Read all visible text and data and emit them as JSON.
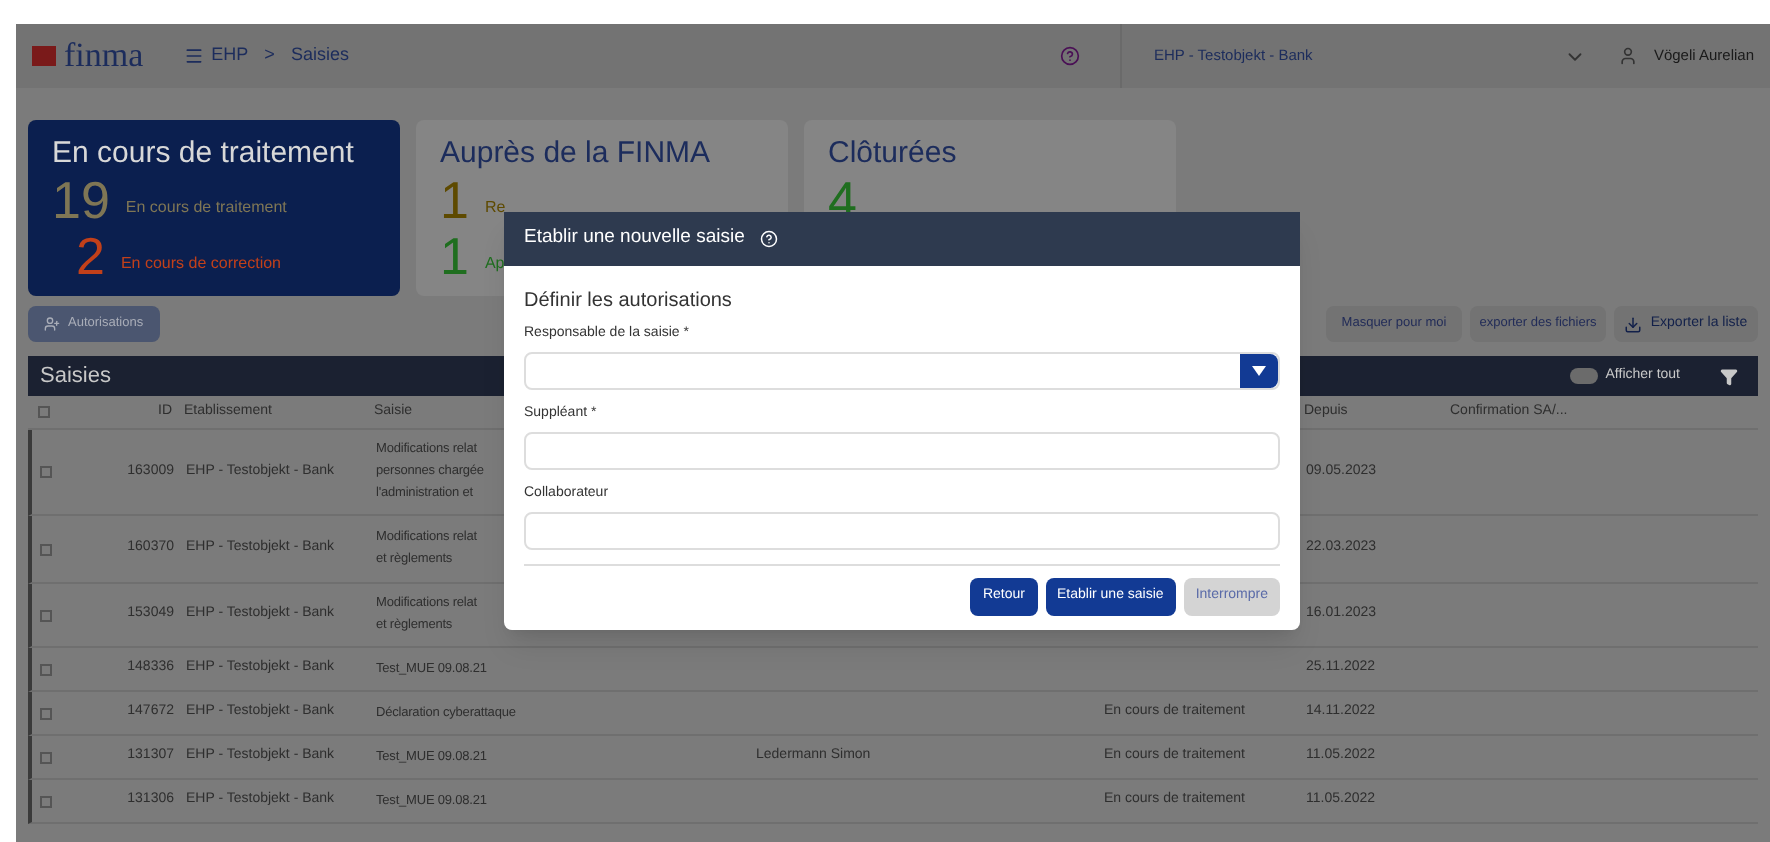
{
  "header": {
    "logo": "finma",
    "menu": "EHP",
    "breadcrumb_separator": ">",
    "page": "Saisies",
    "institution": "EHP - Testobjekt - Bank",
    "user": "Vögeli Aurelian"
  },
  "cards": [
    {
      "title": "En cours de traitement",
      "selected": true,
      "counts": [
        {
          "value": "19",
          "label": "En cours de traitement",
          "color": "#7f7655"
        },
        {
          "value": "2",
          "label": "En cours de correction",
          "color": "#c2401a"
        }
      ]
    },
    {
      "title": "Auprès de la FINMA",
      "selected": false,
      "counts": [
        {
          "value": "1",
          "label": "Re",
          "color": "#5e4a00"
        },
        {
          "value": "1",
          "label": "Ap",
          "color": "#1f6e1f"
        }
      ]
    },
    {
      "title": "Clôturées",
      "selected": false,
      "counts": [
        {
          "value": "4",
          "color": "#1f6e1f"
        }
      ]
    }
  ],
  "toolbar": {
    "left": "Autorisations",
    "right": [
      {
        "label": "Masquer pour moi",
        "kind": "plain"
      },
      {
        "label": "exporter des fichiers",
        "kind": "plain"
      },
      {
        "label": "Exporter la liste",
        "kind": "download"
      }
    ]
  },
  "table": {
    "title": "Saisies",
    "toggle": {
      "label": "Afficher tout",
      "on": false
    },
    "select_all_checked": false,
    "columns": [
      "ID",
      "Etablissement",
      "Saisie",
      "Depuis",
      "Confirmation SA/..."
    ],
    "rows": [
      {
        "checked": false,
        "id": "163009",
        "institution": "EHP - Testobjekt - Bank",
        "saisie": "Modifications relat\npersonnes chargée\nl'administration et",
        "person": "",
        "status": "",
        "since": "09.05.2023"
      },
      {
        "checked": false,
        "id": "160370",
        "institution": "EHP - Testobjekt - Bank",
        "saisie": "Modifications relat\net règlements",
        "person": "",
        "status": "",
        "since": "22.03.2023"
      },
      {
        "checked": false,
        "id": "153049",
        "institution": "EHP - Testobjekt - Bank",
        "saisie": "Modifications relat\net règlements",
        "person": "",
        "status": "",
        "since": "16.01.2023"
      },
      {
        "checked": false,
        "id": "148336",
        "institution": "EHP - Testobjekt - Bank",
        "saisie": "Test_MUE 09.08.21",
        "person": "",
        "status": "",
        "since": "25.11.2022"
      },
      {
        "checked": false,
        "id": "147672",
        "institution": "EHP - Testobjekt - Bank",
        "saisie": "Déclaration cyberattaque",
        "person": "",
        "status": "En cours de traitement",
        "since": "14.11.2022"
      },
      {
        "checked": false,
        "id": "131307",
        "institution": "EHP - Testobjekt - Bank",
        "saisie": "Test_MUE 09.08.21",
        "person": "Ledermann Simon",
        "status": "En cours de traitement",
        "since": "11.05.2022"
      },
      {
        "checked": false,
        "id": "131306",
        "institution": "EHP - Testobjekt - Bank",
        "saisie": "Test_MUE 09.08.21",
        "person": "",
        "status": "En cours de traitement",
        "since": "11.05.2022"
      }
    ]
  },
  "dialog": {
    "title": "Etablir une nouvelle saisie",
    "section": "Définir les autorisations",
    "fields": [
      {
        "label": "Responsable de la saisie *",
        "kind": "select"
      },
      {
        "label": "Suppléant *",
        "kind": "text"
      },
      {
        "label": "Collaborateur",
        "kind": "text"
      }
    ],
    "buttons": [
      {
        "label": "Retour",
        "disabled": false
      },
      {
        "label": "Etablir une saisie",
        "disabled": false
      },
      {
        "label": "Interrompre",
        "disabled": true
      }
    ]
  }
}
